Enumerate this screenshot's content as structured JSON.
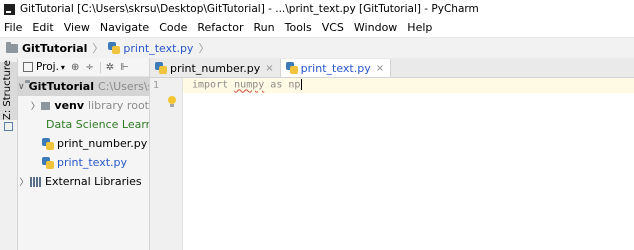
{
  "window": {
    "title": "GitTutorial [C:\\Users\\skrsu\\Desktop\\GitTutorial] - ...\\print_text.py [GitTutorial] - PyCharm"
  },
  "menu": [
    "File",
    "Edit",
    "View",
    "Navigate",
    "Code",
    "Refactor",
    "Run",
    "Tools",
    "VCS",
    "Window",
    "Help"
  ],
  "breadcrumb": {
    "project": "GitTutorial",
    "file": "print_text.py"
  },
  "toolstrip": {
    "structure_label": "Z: Structure"
  },
  "project_panel": {
    "header_label": "Proj.",
    "header_tools": [
      "⊕",
      "÷",
      "✲",
      "⊩"
    ],
    "tree": [
      {
        "label": "GitTutorial",
        "path": "C:\\Users\\skr",
        "expanded": true
      },
      {
        "label": "venv",
        "suffix": "library root"
      },
      {
        "label": "Data Science Learner"
      },
      {
        "label": "print_number.py"
      },
      {
        "label": "print_text.py"
      },
      {
        "label": "External Libraries"
      }
    ]
  },
  "editor": {
    "tabs": [
      {
        "label": "print_number.py",
        "active": false,
        "close": "×"
      },
      {
        "label": "print_text.py",
        "active": true,
        "close": "×"
      }
    ],
    "line_number": "1",
    "code": {
      "import": "import",
      "module": "numpy",
      "as": "as",
      "alias": "np"
    }
  },
  "colors": {
    "selection": "#d5d5d5",
    "current_line": "#fffae3",
    "link_blue": "#2757c9",
    "green": "#2f7a25",
    "warning_red": "#d24b4b"
  }
}
